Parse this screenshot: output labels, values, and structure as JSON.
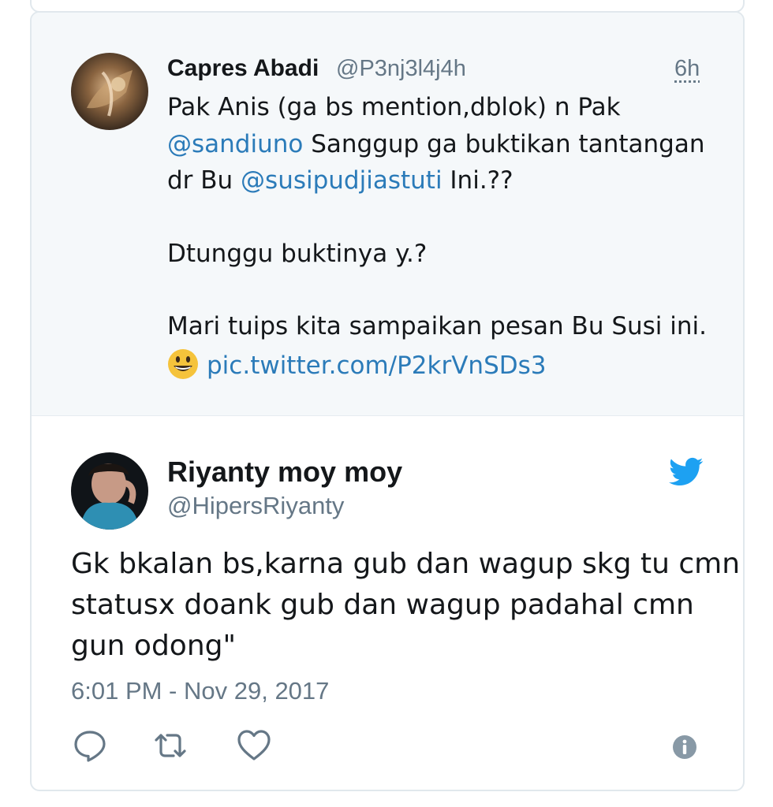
{
  "quoted_tweet": {
    "display_name": "Capres Abadi",
    "handle": "@P3nj3l4j4h",
    "time": "6h",
    "line1": "Pak Anis (ga bs mention,dblok) n Pak",
    "mention1": "@sandiuno",
    "line2_rest": " Sanggup ga buktikan tantangan",
    "line3_pre": "dr Bu ",
    "mention2": "@susipudjiastuti",
    "line3_rest": " Ini.??",
    "line4": "Dtunggu buktinya y.?",
    "line5": "Mari tuips kita sampaikan pesan Bu Susi ini.",
    "emoji": "grinning-face-emoji",
    "pic_link": "pic.twitter.com/P2krVnSDs3"
  },
  "main_tweet": {
    "display_name": "Riyanty moy moy",
    "handle": "@HipersRiyanty",
    "text_lines": [
      "Gk bkalan bs,karna gub dan wagup skg tu cmn",
      "statusx doank gub dan wagup padahal cmn",
      "gun odong\""
    ],
    "timestamp": "6:01 PM - Nov 29, 2017",
    "brand_icon": "twitter-bird-icon"
  },
  "actions": {
    "reply": "reply-icon",
    "retweet": "retweet-icon",
    "like": "heart-icon",
    "info": "info-icon"
  },
  "colors": {
    "link": "#2b7bb9",
    "brand": "#1da1f2",
    "muted": "#657786",
    "quoted_bg": "#f5f8fa",
    "border": "#e1e8ed"
  }
}
